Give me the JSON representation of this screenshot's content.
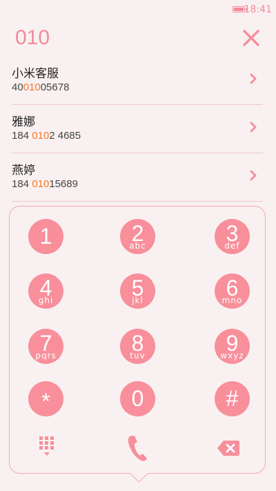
{
  "status": {
    "time": "18:41"
  },
  "search": {
    "query": "010"
  },
  "contacts": [
    {
      "name": "小米客服",
      "number_pre": "40",
      "number_match": "010",
      "number_post": "05678"
    },
    {
      "name": "雅娜",
      "number_pre": "184 ",
      "number_match": "010",
      "number_post": "2 4685"
    },
    {
      "name": "燕婷",
      "number_pre": "184 ",
      "number_match": "010",
      "number_post": "15689"
    }
  ],
  "keypad": [
    {
      "digit": "1",
      "letters": ""
    },
    {
      "digit": "2",
      "letters": "abc"
    },
    {
      "digit": "3",
      "letters": "def"
    },
    {
      "digit": "4",
      "letters": "ghi"
    },
    {
      "digit": "5",
      "letters": "jkl"
    },
    {
      "digit": "6",
      "letters": "mno"
    },
    {
      "digit": "7",
      "letters": "pqrs"
    },
    {
      "digit": "8",
      "letters": "tuv"
    },
    {
      "digit": "9",
      "letters": "wxyz"
    },
    {
      "digit": "*",
      "letters": ""
    },
    {
      "digit": "0",
      "letters": ""
    },
    {
      "digit": "#",
      "letters": ""
    }
  ],
  "colors": {
    "accent": "#f88f9b",
    "highlight": "#f0782c",
    "background": "#f9f1f1"
  },
  "icons": {
    "close": "close-icon",
    "chevron": "chevron-right-icon",
    "dialpad": "dialpad-collapse-icon",
    "call": "phone-icon",
    "delete": "backspace-icon"
  }
}
